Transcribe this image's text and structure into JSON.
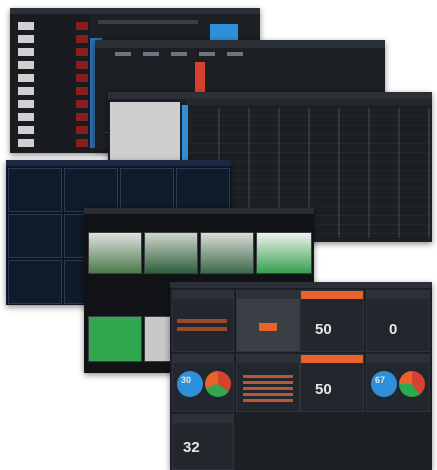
{
  "window1": {
    "title": ""
  },
  "window2": {
    "title": ""
  },
  "window3": {
    "title": ""
  },
  "window4": {
    "title": ""
  },
  "window5": {
    "title": ""
  },
  "window6": {
    "title": "",
    "gauge_values": [
      "50",
      "0",
      "50",
      "32"
    ],
    "pie_values": [
      "30",
      "67"
    ]
  },
  "colors": {
    "accent_blue": "#2f8fd8",
    "accent_orange": "#e8622a",
    "accent_red": "#d7412f",
    "accent_green": "#2fa84f",
    "panel_dark": "#1c1f24"
  }
}
